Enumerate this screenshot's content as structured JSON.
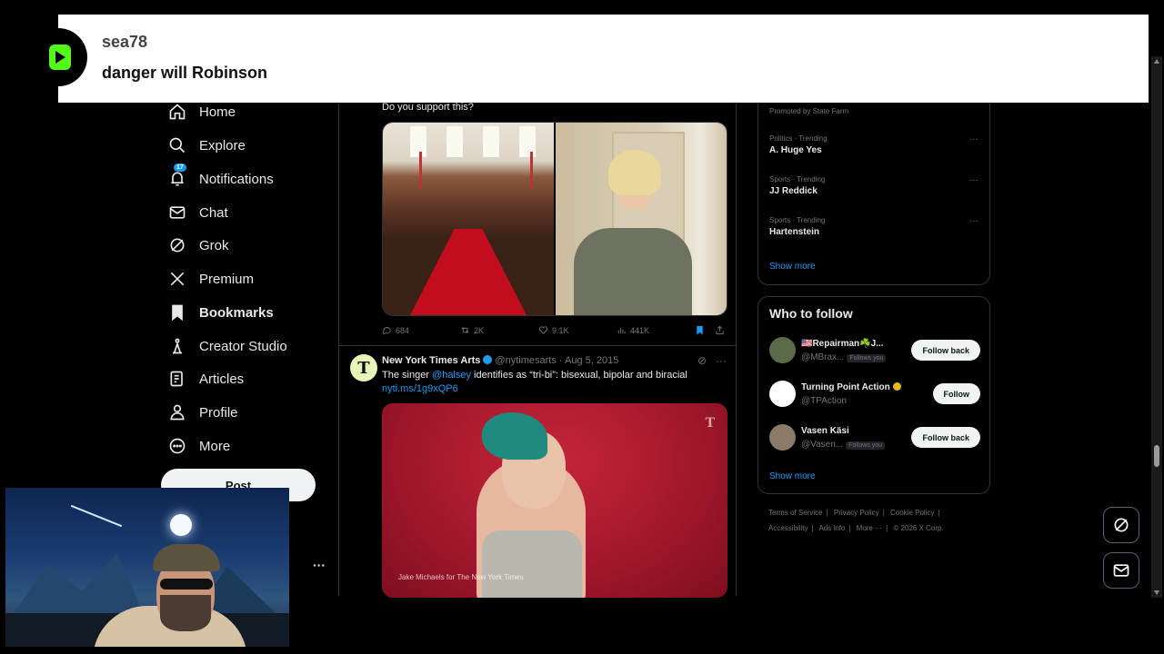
{
  "overlay": {
    "username": "sea78",
    "message": "danger will Robinson"
  },
  "nav": {
    "items": [
      {
        "label": "Home",
        "icon": "home-icon"
      },
      {
        "label": "Explore",
        "icon": "search-icon"
      },
      {
        "label": "Notifications",
        "icon": "bell-icon",
        "badge": "17"
      },
      {
        "label": "Chat",
        "icon": "mail-icon"
      },
      {
        "label": "Grok",
        "icon": "grok-icon"
      },
      {
        "label": "Premium",
        "icon": "x-logo-icon"
      },
      {
        "label": "Bookmarks",
        "icon": "bookmark-icon"
      },
      {
        "label": "Creator Studio",
        "icon": "creator-icon"
      },
      {
        "label": "Articles",
        "icon": "articles-icon"
      },
      {
        "label": "Profile",
        "icon": "person-icon"
      },
      {
        "label": "More",
        "icon": "more-circle-icon"
      }
    ],
    "post_label": "Post",
    "more_dots": "···"
  },
  "tweet1": {
    "text": "Do you support this?",
    "replies": "684",
    "retweets": "2K",
    "likes": "9.1K",
    "views": "441K"
  },
  "tweet2": {
    "name": "New York Times Arts",
    "handle": "@nytimesarts",
    "date": "· Aug 5, 2015",
    "text_before": "The singer ",
    "mention": "@halsey",
    "text_after": " identifies as “tri-bi”: bisexual, bipolar and biracial",
    "url": "nyti.ms/1g9xQP6",
    "photo_credit": "Jake Michaels for The New York Times",
    "media_logo": "T",
    "avatar_letter": "T"
  },
  "trends": {
    "promoted": "Promoted by State Farm",
    "items": [
      {
        "category": "Politics · Trending",
        "title": "A. Huge Yes"
      },
      {
        "category": "Sports · Trending",
        "title": "JJ Reddick"
      },
      {
        "category": "Sports · Trending",
        "title": "Hartenstein"
      }
    ],
    "show_more": "Show more"
  },
  "who_to_follow": {
    "title": "Who to follow",
    "accounts": [
      {
        "name": "🇺🇸Repairman☘️J...",
        "handle": "@MBrax...",
        "follows_you": "Follows you",
        "button": "Follow back"
      },
      {
        "name": "Turning Point Action",
        "handle": "@TPAction",
        "follows_you": "",
        "button": "Follow"
      },
      {
        "name": "Vasen Käsi",
        "handle": "@Vasen...",
        "follows_you": "Follows you",
        "button": "Follow back"
      }
    ],
    "show_more": "Show more"
  },
  "footer": {
    "row1": [
      "Terms of Service",
      "Privacy Policy",
      "Cookie Policy"
    ],
    "row2": [
      "Accessibility",
      "Ads info",
      "More ···",
      "© 2026 X Corp."
    ]
  },
  "colors": {
    "accent": "#1d9bf0",
    "background": "#000000",
    "kick_green": "#53fc18"
  }
}
